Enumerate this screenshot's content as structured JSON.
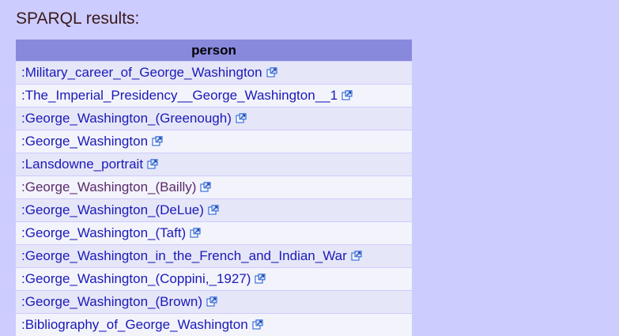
{
  "heading": "SPARQL results:",
  "table": {
    "header": "person",
    "rows": [
      {
        "label": ":Military_career_of_George_Washington",
        "visited": false
      },
      {
        "label": ":The_Imperial_Presidency__George_Washington__1",
        "visited": false
      },
      {
        "label": ":George_Washington_(Greenough)",
        "visited": false
      },
      {
        "label": ":George_Washington",
        "visited": false
      },
      {
        "label": ":Lansdowne_portrait",
        "visited": false
      },
      {
        "label": ":George_Washington_(Bailly)",
        "visited": true
      },
      {
        "label": ":George_Washington_(DeLue)",
        "visited": false
      },
      {
        "label": ":George_Washington_(Taft)",
        "visited": false
      },
      {
        "label": ":George_Washington_in_the_French_and_Indian_War",
        "visited": false
      },
      {
        "label": ":George_Washington_(Coppini,_1927)",
        "visited": false
      },
      {
        "label": ":George_Washington_(Brown)",
        "visited": false
      },
      {
        "label": ":Bibliography_of_George_Washington",
        "visited": false
      }
    ]
  },
  "colors": {
    "page_background": "#ccccff",
    "header_background": "#8888dd",
    "link": "#1a1ab8",
    "visited_link": "#5a2a6a"
  },
  "icons": {
    "external_link": "external-link-icon"
  }
}
